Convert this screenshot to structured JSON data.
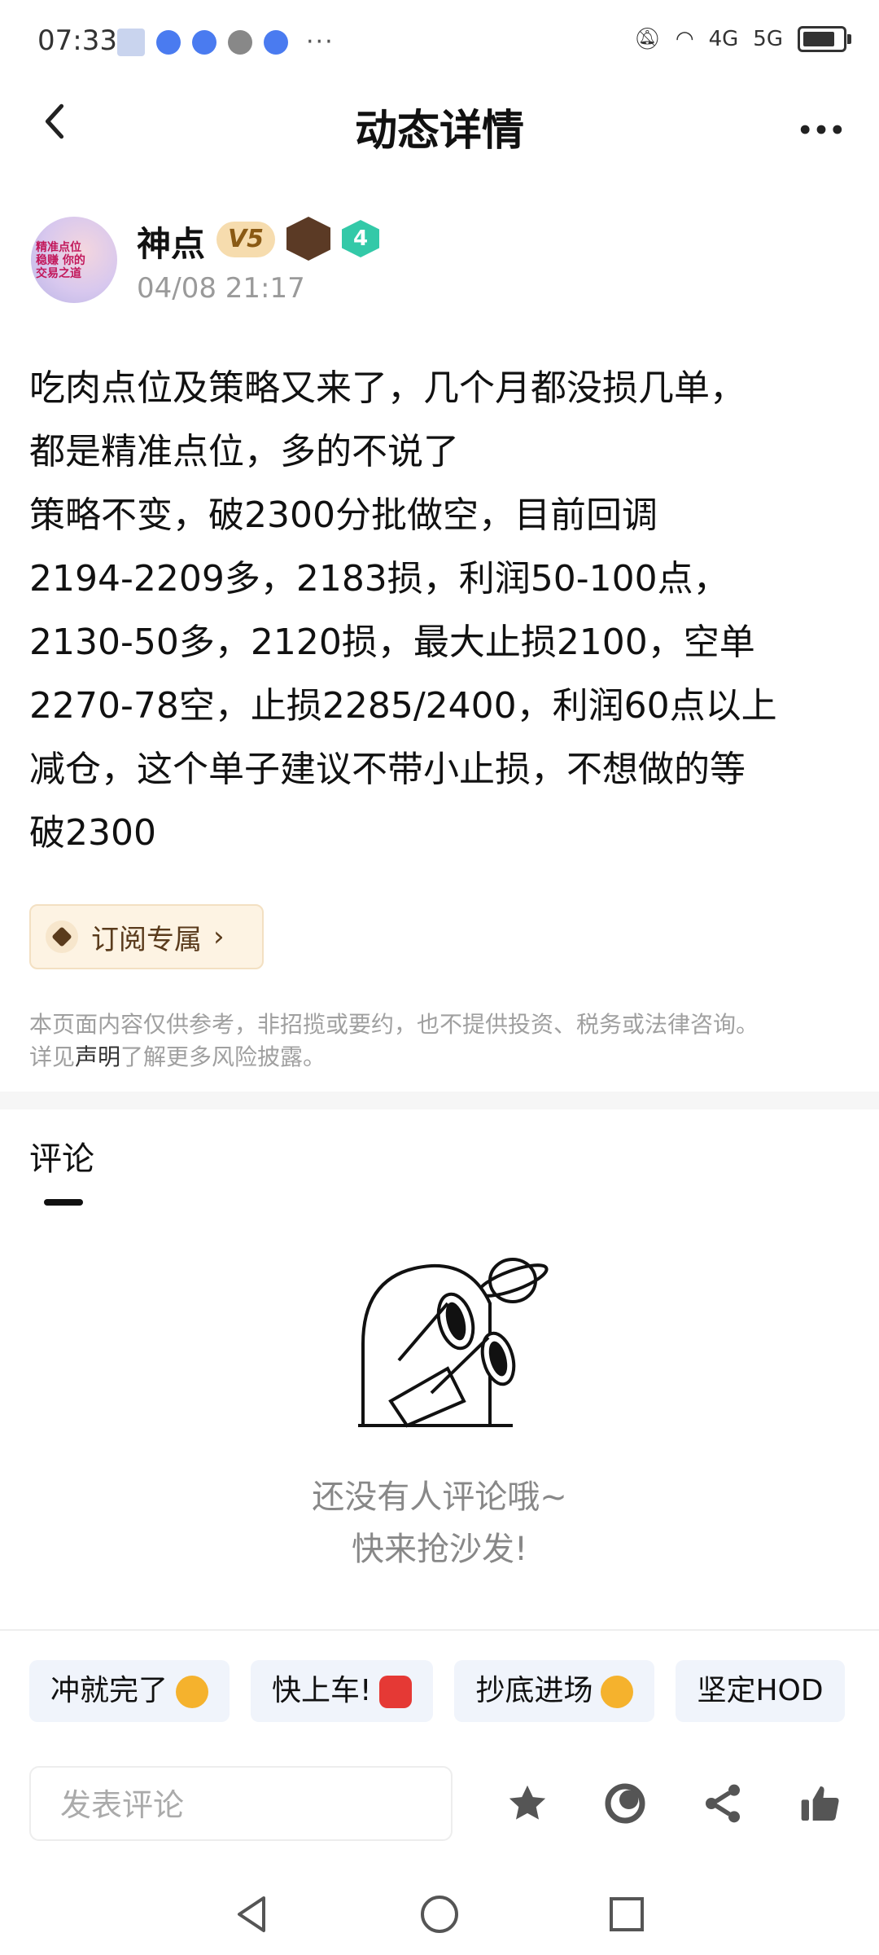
{
  "status_bar": {
    "time": "07:33",
    "net_4g": "4G",
    "net_5g": "5G"
  },
  "header": {
    "title": "动态详情"
  },
  "author": {
    "name": "神点",
    "level_badge": "V5",
    "rank_badge": "4",
    "time": "04/08 21:17",
    "avatar_text": "精准点位 稳赚 你的交易之道"
  },
  "post": {
    "body": "吃肉点位及策略又来了，几个月都没损几单，\n都是精准点位，多的不说了\n策略不变，破2300分批做空，目前回调\n2194-2209多，2183损，利润50-100点，\n2130-50多，2120损，最大止损2100，空单\n2270-78空，止损2285/2400，利润60点以上\n减仓，这个单子建议不带小止损，不想做的等\n破2300"
  },
  "subscribe": {
    "label": "订阅专属",
    "arrow": "›"
  },
  "disclaimer": {
    "line1": "本页面内容仅供参考，非招揽或要约，也不提供投资、税务或法律咨询。",
    "prefix": "详见",
    "link": "声明",
    "suffix": "了解更多风险披露。"
  },
  "comments": {
    "title": "评论",
    "empty_line1": "还没有人评论哦~",
    "empty_line2": "快来抢沙发!"
  },
  "quick_replies": [
    {
      "label": "冲就完了",
      "emoji": "fist-emoji",
      "color": "#f5b22d"
    },
    {
      "label": "快上车!",
      "emoji": "car-emoji",
      "color": "#e53935"
    },
    {
      "label": "抄底进场",
      "emoji": "sunglasses-emoji",
      "color": "#f5b22d"
    },
    {
      "label": "坚定HOD",
      "emoji": "",
      "color": ""
    }
  ],
  "bottom_bar": {
    "input_placeholder": "发表评论",
    "icons": [
      "star-icon",
      "repost-icon",
      "share-icon",
      "thumbs-up-icon"
    ]
  },
  "colors": {
    "accent_badge": "#f6dcae",
    "subscribe_bg": "#fdf3e3",
    "chip_bg": "#f0f4fb",
    "muted_text": "#9a9a9a"
  }
}
